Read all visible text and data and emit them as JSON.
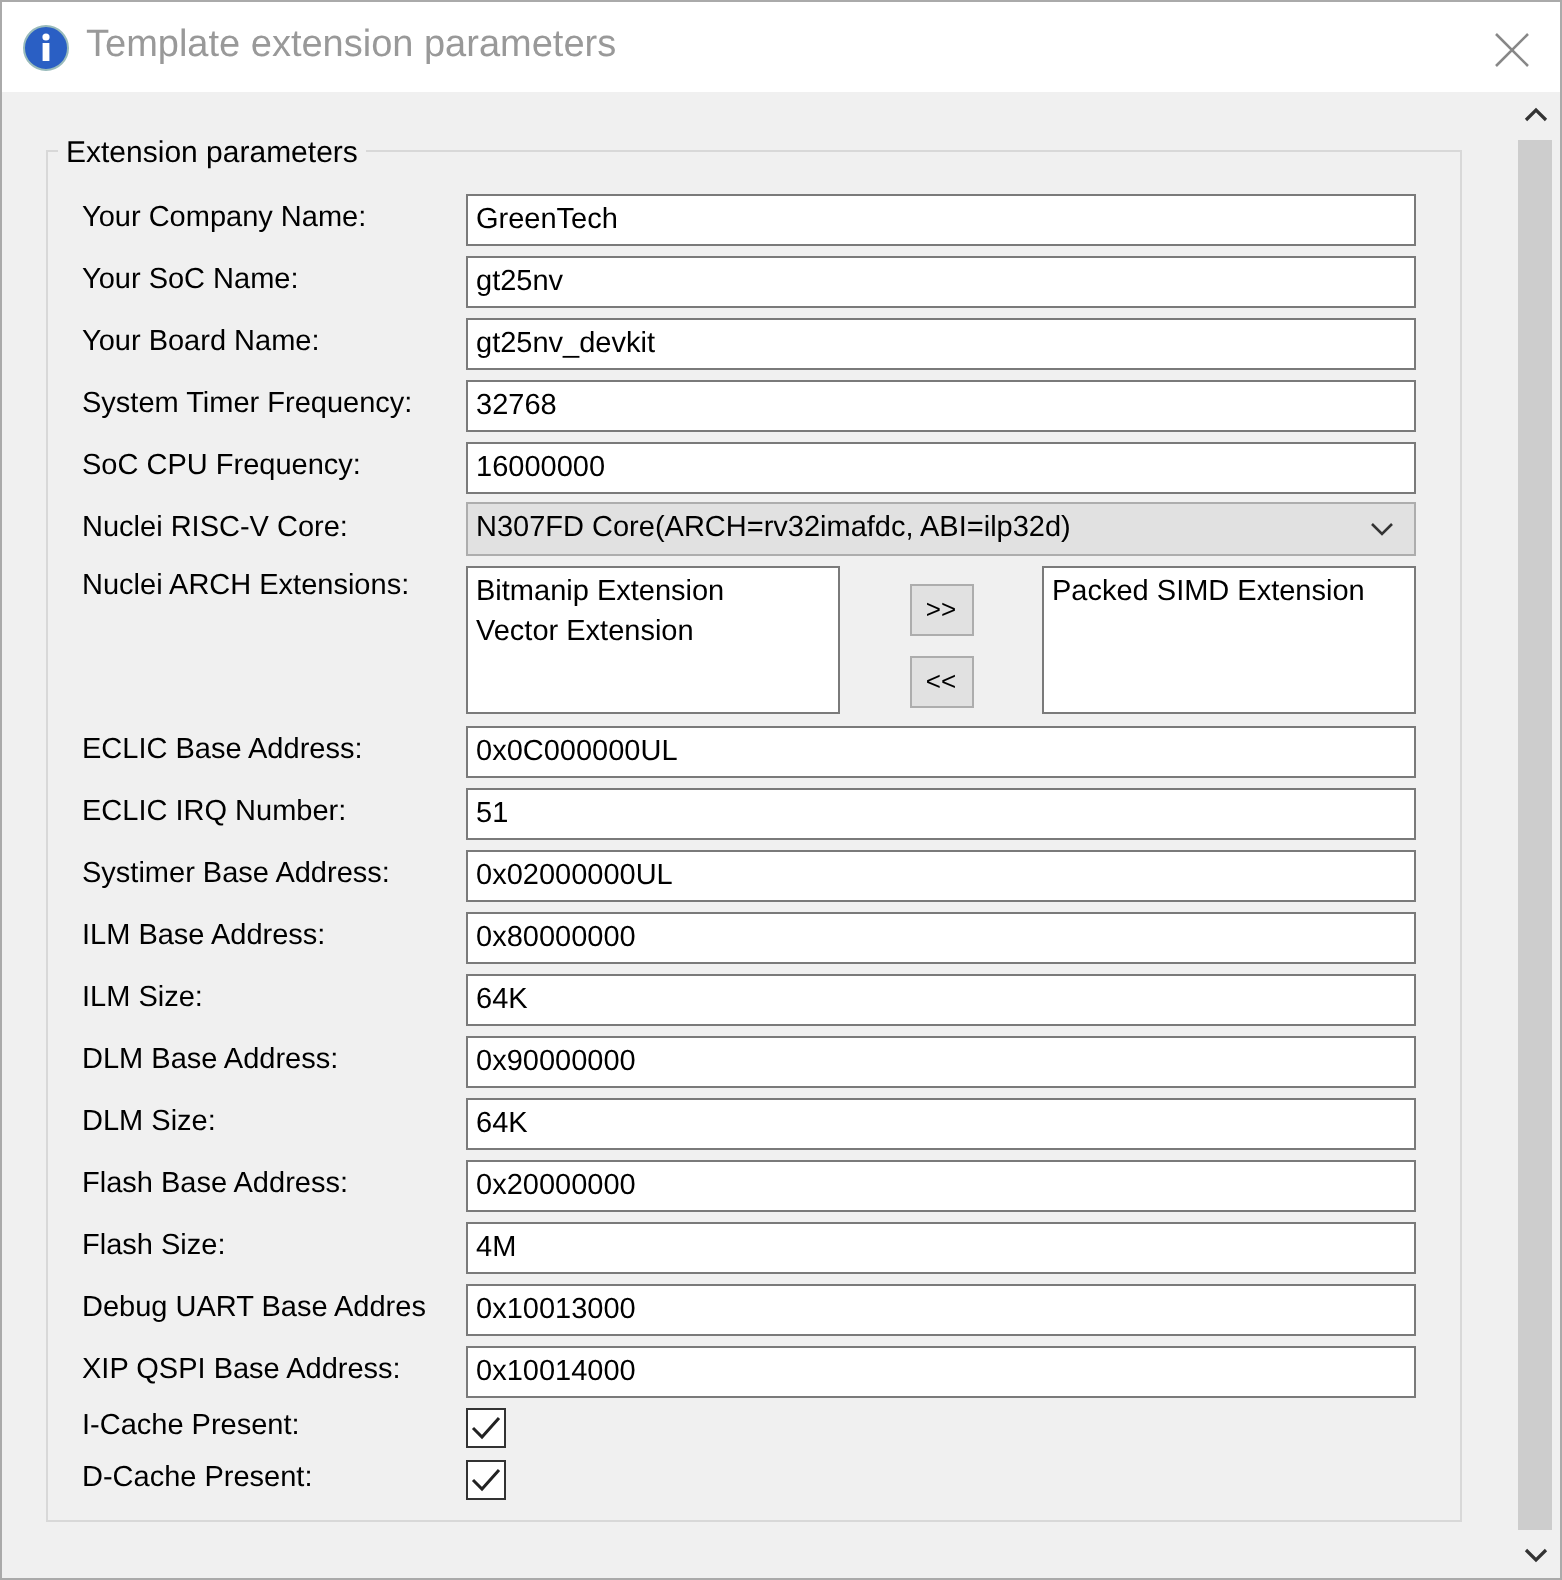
{
  "window": {
    "title": "Template extension parameters"
  },
  "group": {
    "title": "Extension parameters"
  },
  "rows": [
    {
      "kind": "text",
      "label": "Your Company Name:",
      "value": "GreenTech"
    },
    {
      "kind": "text",
      "label": "Your SoC Name:",
      "value": "gt25nv"
    },
    {
      "kind": "text",
      "label": "Your Board Name:",
      "value": "gt25nv_devkit"
    },
    {
      "kind": "text",
      "label": "System Timer Frequency:",
      "value": "32768"
    },
    {
      "kind": "text",
      "label": "SoC CPU Frequency:",
      "value": "16000000"
    },
    {
      "kind": "select",
      "label": "Nuclei RISC-V Core:",
      "value": "N307FD Core(ARCH=rv32imafdc, ABI=ilp32d)"
    },
    {
      "kind": "lists",
      "label": "Nuclei ARCH Extensions:",
      "available": [
        "Bitmanip Extension",
        "Vector Extension"
      ],
      "add_button": ">>",
      "remove_button": "<<",
      "chosen": [
        "Packed SIMD Extension"
      ]
    },
    {
      "kind": "text",
      "label": "ECLIC Base Address:",
      "value": "0x0C000000UL"
    },
    {
      "kind": "text",
      "label": "ECLIC IRQ Number:",
      "value": "51"
    },
    {
      "kind": "text",
      "label": "Systimer Base Address:",
      "value": "0x02000000UL"
    },
    {
      "kind": "text",
      "label": "ILM Base Address:",
      "value": "0x80000000"
    },
    {
      "kind": "text",
      "label": "ILM Size:",
      "value": "64K"
    },
    {
      "kind": "text",
      "label": "DLM Base Address:",
      "value": "0x90000000"
    },
    {
      "kind": "text",
      "label": "DLM Size:",
      "value": "64K"
    },
    {
      "kind": "text",
      "label": "Flash Base Address:",
      "value": "0x20000000"
    },
    {
      "kind": "text",
      "label": "Flash Size:",
      "value": "4M"
    },
    {
      "kind": "text",
      "label": "Debug UART Base Addres",
      "value": "0x10013000"
    },
    {
      "kind": "text",
      "label": "XIP QSPI Base Address:",
      "value": "0x10014000"
    },
    {
      "kind": "checkbox",
      "label": "I-Cache Present:",
      "checked": true
    },
    {
      "kind": "checkbox",
      "label": "D-Cache Present:",
      "checked": true
    }
  ]
}
